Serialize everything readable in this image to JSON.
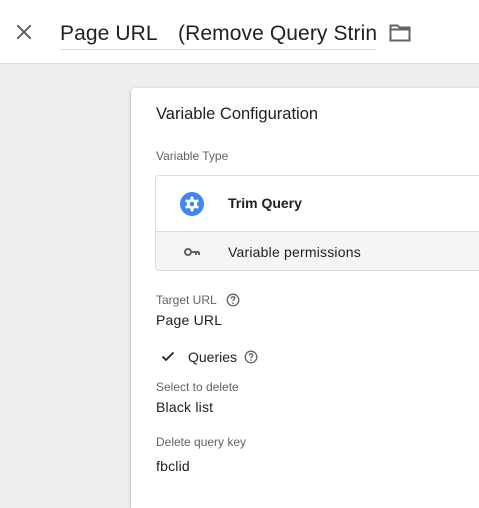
{
  "header": {
    "title_value": "Page URL　(Remove Query String)"
  },
  "config": {
    "title": "Variable Configuration",
    "variable_type_label": "Variable Type",
    "type_name": "Trim Query",
    "permissions_label": "Variable permissions",
    "target_url_label": "Target URL",
    "target_url_value": "Page URL",
    "queries_label": "Queries",
    "select_to_delete_label": "Select to delete",
    "select_to_delete_value": "Black list",
    "delete_query_key_label": "Delete query key",
    "delete_query_key_value": "fbclid"
  },
  "colors": {
    "accent_blue": "#4285f4",
    "icon_gray": "#5f6368"
  },
  "icons": {
    "close": "close-icon",
    "folder": "folder-icon",
    "type": "gear-icon",
    "permissions": "key-icon",
    "help": "help-icon",
    "check": "check-icon"
  }
}
